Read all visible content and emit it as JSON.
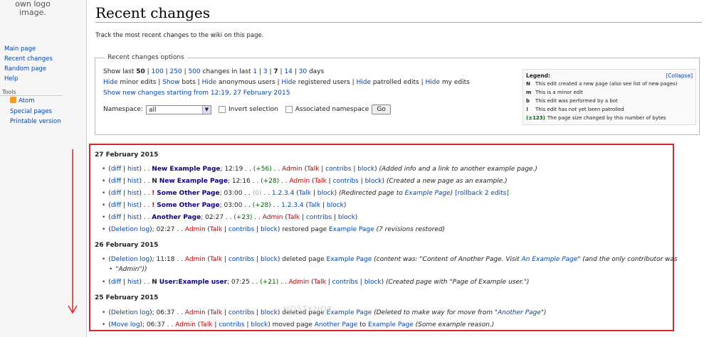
{
  "logo": {
    "text": "own logo image."
  },
  "sidebar": {
    "nav": [
      "Main page",
      "Recent changes",
      "Random page",
      "Help"
    ],
    "tools_heading": "Tools",
    "tools": [
      "Atom",
      "Special pages",
      "Printable version"
    ]
  },
  "page": {
    "title": "Recent changes",
    "intro": "Track the most recent changes to the wiki on this page."
  },
  "options": {
    "legend_label": "Recent changes options",
    "show_last": "Show last",
    "limits": [
      "50",
      "100",
      "250",
      "500"
    ],
    "changes_in_last": "changes in last",
    "days": [
      "1",
      "3",
      "7",
      "14",
      "30"
    ],
    "days_label": "days",
    "hide_word": "Hide",
    "hide_items": [
      "minor edits",
      "bots",
      "anonymous users",
      "registered users",
      "patrolled edits",
      "my edits"
    ],
    "show_bots": "Show",
    "new_changes_link": "Show new changes starting from 12:19, 27 February 2015",
    "namespace_label": "Namespace:",
    "namespace_value": "all",
    "invert_label": "Invert selection",
    "associated_label": "Associated namespace",
    "go_label": "Go"
  },
  "legend": {
    "title": "Legend:",
    "collapse": "[Collapse]",
    "rows": [
      {
        "key": "N",
        "text": "This edit created a new page (also see list of new pages)"
      },
      {
        "key": "m",
        "text": "This is a minor edit"
      },
      {
        "key": "b",
        "text": "This edit was performed by a bot"
      },
      {
        "key": "!",
        "text": "This edit has not yet been patrolled"
      },
      {
        "key": "(±123)",
        "text": "The page size changed by this number of bytes"
      }
    ]
  },
  "changes": {
    "days": [
      {
        "date": "27 February 2015"
      },
      {
        "date": "26 February 2015"
      },
      {
        "date": "25 February 2015"
      }
    ],
    "entries": {
      "e1": {
        "diff": "diff",
        "hist": "hist",
        "page": "New Example Page",
        "time": "12:19",
        "size": "(+56)",
        "user": "Admin",
        "talk": "Talk",
        "contribs": "contribs",
        "block": "block",
        "comment": "(Added info and a link to another example page.)"
      },
      "e2": {
        "flag": "N",
        "page": "New Example Page",
        "time": "12:16",
        "size": "(+28)",
        "user": "Admin",
        "comment": "(Created a new page as an example.)"
      },
      "e3": {
        "flag": "!",
        "page": "Some Other Page",
        "time": "03:00",
        "size": "(0)",
        "user": "1.2.3.4",
        "comment_pre": "(Redirected page to ",
        "comment_link": "Example Page",
        "comment_post": ")",
        "rollback": "[rollback 2 edits]"
      },
      "e4": {
        "flag": "!",
        "page": "Some Other Page",
        "time": "03:00",
        "size": "(+28)",
        "user": "1.2.3.4"
      },
      "e5": {
        "page": "Another Page",
        "time": "02:27",
        "size": "(+23)",
        "user": "Admin"
      },
      "e6": {
        "log": "Deletion log",
        "time": "02:27",
        "user": "Admin",
        "action": "restored page",
        "target": "Example Page",
        "comment": "(7 revisions restored)"
      },
      "e7": {
        "log": "Deletion log",
        "time": "11:18",
        "user": "Admin",
        "action": "deleted page",
        "target": "Example Page",
        "comment_pre": "(content was: \"Content of Another Page. Visit ",
        "comment_link": "An Example Page",
        "comment_post": "\" (and the only contributor was",
        "comment_line2": "\"Admin\"))"
      },
      "e8": {
        "flag": "N",
        "page": "User:Example user",
        "time": "07:25",
        "size": "(+21)",
        "user": "Admin",
        "comment": "(Created page with \"Page of Example user.\")"
      },
      "e9": {
        "log": "Deletion log",
        "time": "06:37",
        "user": "Admin",
        "action": "deleted page",
        "target": "Example Page",
        "comment_pre": "(Deleted to make way for move from \"",
        "comment_link": "Another Page",
        "comment_post": "\")"
      },
      "e10": {
        "log": "Move log",
        "time": "06:37",
        "user": "Admin",
        "action": "moved page",
        "target": "Another Page",
        "to": "to",
        "target2": "Example Page",
        "comment": "(Some example reason.)"
      }
    },
    "sep_dots": ". .",
    "talk": "Talk",
    "contribs": "contribs",
    "block": "block",
    "diff": "diff",
    "hist": "hist"
  },
  "watermark": "HOSTKNOX",
  "colors": {
    "highlight_border": "#d62626",
    "link": "#0645ad",
    "red_link": "#ba0000"
  }
}
